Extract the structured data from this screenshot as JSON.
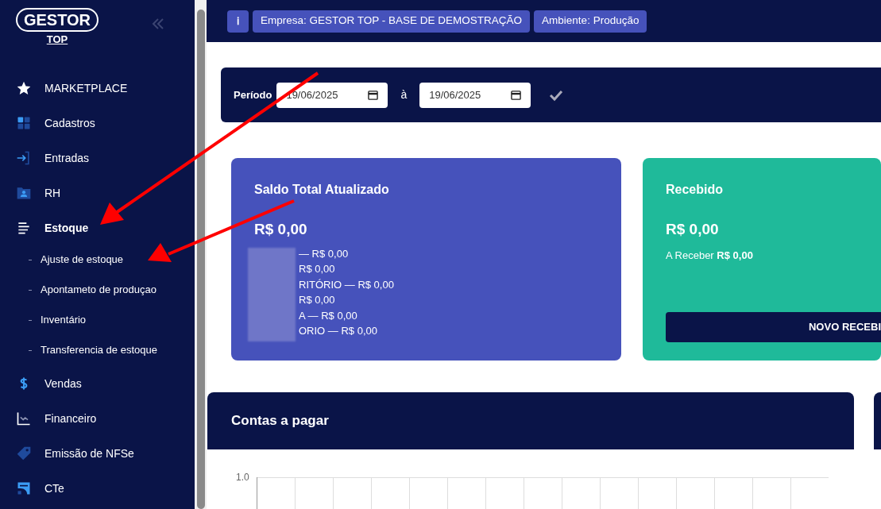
{
  "logo": {
    "title": "GESTOR",
    "subtitle": "TOP"
  },
  "sidebar": {
    "items": [
      {
        "label": "MARKETPLACE",
        "kind": "star",
        "expanded": false
      },
      {
        "label": "Cadastros",
        "kind": "grid",
        "expanded": false
      },
      {
        "label": "Entradas",
        "kind": "enter",
        "expanded": false
      },
      {
        "label": "RH",
        "kind": "folder",
        "expanded": false
      },
      {
        "label": "Estoque",
        "kind": "lines",
        "expanded": true,
        "children": [
          {
            "label": "Ajuste de estoque"
          },
          {
            "label": "Apontameto de produçao"
          },
          {
            "label": "Inventário"
          },
          {
            "label": "Transferencia de estoque"
          }
        ]
      },
      {
        "label": "Vendas",
        "kind": "dollar",
        "expanded": false
      },
      {
        "label": "Financeiro",
        "kind": "chart",
        "expanded": false
      },
      {
        "label": "Emissão de NFSe",
        "kind": "tag",
        "expanded": false
      },
      {
        "label": "CTe",
        "kind": "truck",
        "expanded": false
      }
    ]
  },
  "header": {
    "info": "ℹ",
    "badges": [
      "Empresa: GESTOR TOP - BASE DE DEMOSTRAÇÃO",
      "Ambiente: Produção"
    ]
  },
  "period": {
    "label": "Período",
    "from": "19/06/2025",
    "separator": "à",
    "to": "19/06/2025"
  },
  "cards": [
    {
      "kind": "balance",
      "title": "Saldo Total Atualizado",
      "amount": "R$ 0,00",
      "lines": [
        "— R$ 0,00",
        "R$ 0,00",
        "RITÓRIO — R$ 0,00",
        "R$ 0,00",
        "A — R$ 0,00",
        "ORIO — R$ 0,00"
      ]
    },
    {
      "kind": "received",
      "title": "Recebido",
      "amount": "R$ 0,00",
      "note": "A Receber **R$ 0,00**",
      "button": "NOVO RECEBI"
    }
  ],
  "panel": {
    "title": "Contas a pagar",
    "y_tick": "1.0"
  }
}
